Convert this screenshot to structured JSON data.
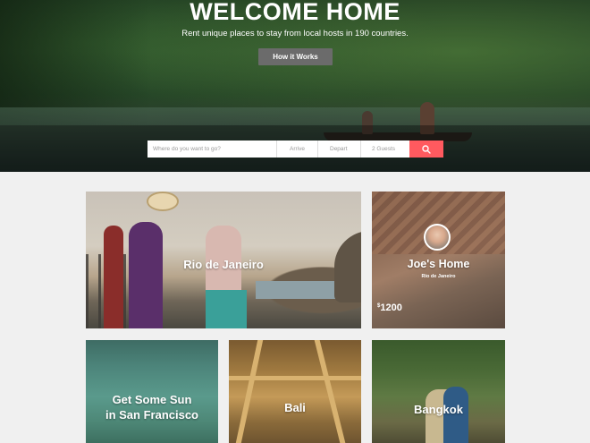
{
  "hero": {
    "title": "WELCOME HOME",
    "subtitle": "Rent unique places to stay from local hosts in 190 countries.",
    "cta_label": "How it Works"
  },
  "search": {
    "where_placeholder": "Where do you want to go?",
    "arrive_placeholder": "Arrive",
    "depart_placeholder": "Depart",
    "guests_value": "2 Guests",
    "search_icon": "search-icon"
  },
  "cards": {
    "rio": {
      "title": "Rio de Janeiro"
    },
    "joe": {
      "title": "Joe's Home",
      "subtitle": "Rio de Janeiro",
      "currency": "$",
      "price": "1200"
    },
    "sf": {
      "title_line1": "Get Some Sun",
      "title_line2": "in San Francisco"
    },
    "bali": {
      "title": "Bali"
    },
    "bangkok": {
      "title": "Bangkok"
    }
  },
  "colors": {
    "accent": "#ff5a5f",
    "page_bg": "#f0f0f0",
    "button_gray": "#6b6b6b"
  }
}
